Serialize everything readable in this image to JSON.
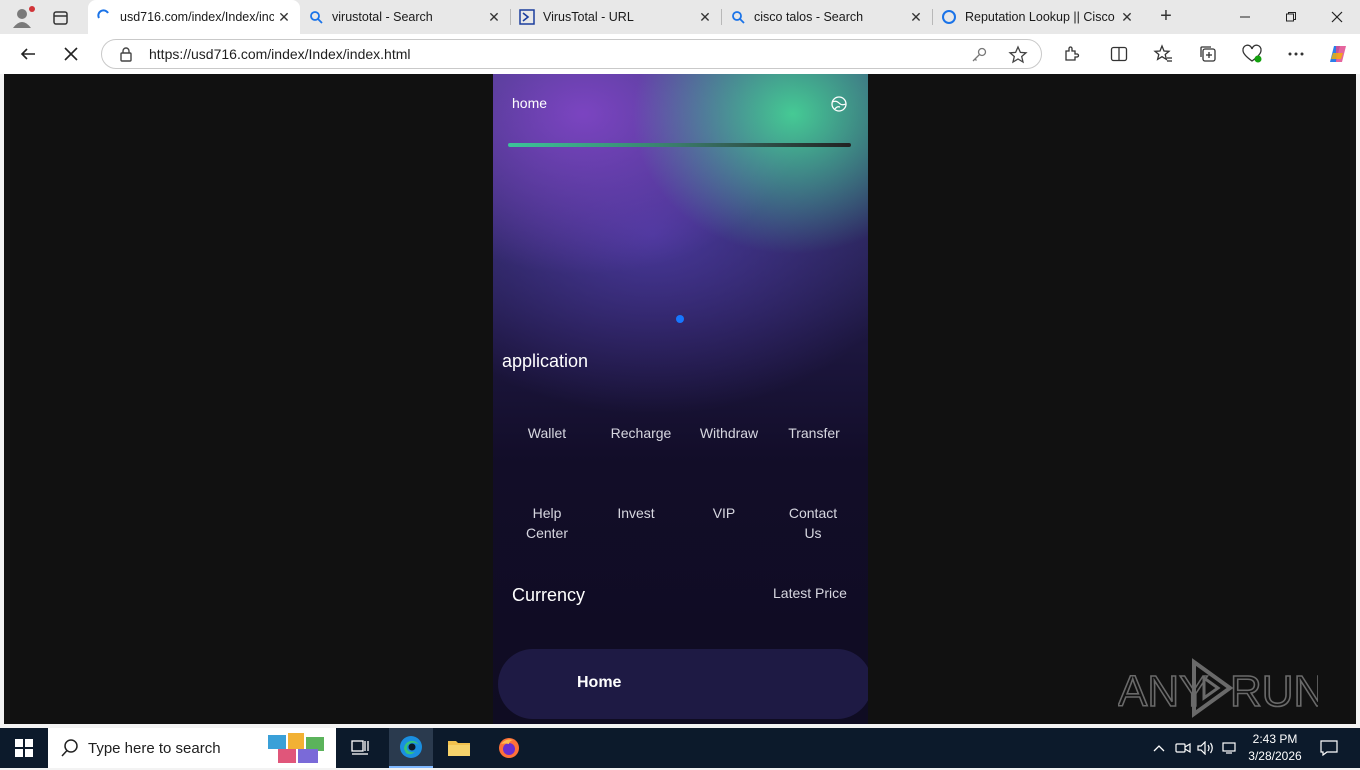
{
  "browser": {
    "tabs": [
      {
        "title": "usd716.com/index/Index/inc",
        "active": true,
        "icon": "loading-spinner-icon"
      },
      {
        "title": "virustotal - Search",
        "active": false,
        "icon": "search-icon"
      },
      {
        "title": "VirusTotal - URL",
        "active": false,
        "icon": "virustotal-icon"
      },
      {
        "title": "cisco talos - Search",
        "active": false,
        "icon": "search-icon"
      },
      {
        "title": "Reputation Lookup || Cisco T",
        "active": false,
        "icon": "talos-icon"
      }
    ],
    "url": "https://usd716.com/index/Index/index.html",
    "new_tab_symbol": "+",
    "close_symbol": "✕"
  },
  "page": {
    "header_title": "home",
    "section_application": "application",
    "apps": [
      {
        "label": "Wallet"
      },
      {
        "label": "Recharge"
      },
      {
        "label": "Withdraw"
      },
      {
        "label": "Transfer"
      },
      {
        "label": "Help Center"
      },
      {
        "label": "Invest"
      },
      {
        "label": "VIP"
      },
      {
        "label": "Contact Us"
      }
    ],
    "currency_title": "Currency",
    "latest_price": "Latest Price",
    "bottom_nav_home": "Home",
    "accent_color": "#1677ff"
  },
  "watermark": {
    "text": "ANY RUN"
  },
  "taskbar": {
    "search_placeholder": "Type here to search",
    "time": "2:43 PM",
    "date": "3/28/2026"
  }
}
